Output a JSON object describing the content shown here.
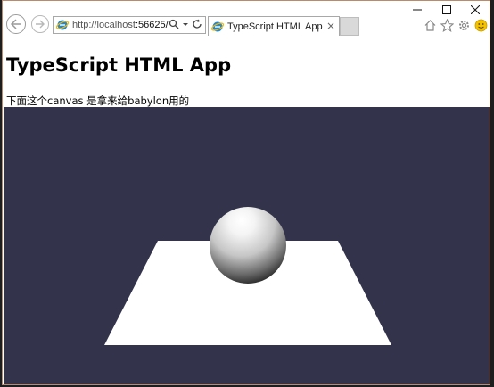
{
  "browser": {
    "address_host": "http://localhost",
    "address_port": ":56625/",
    "tab_title": "TypeScript HTML App",
    "tab_close": "×"
  },
  "page": {
    "heading": "TypeScript HTML App",
    "description": "下面这个canvas 是拿来给babylon用的"
  },
  "scene": {
    "background": "#33334c",
    "ground_color": "#ffffff",
    "objects": [
      "sphere",
      "ground-plane"
    ]
  },
  "colors": {
    "window_border": "#b98a6c",
    "ie_blue": "#1e88d8",
    "ie_ring": "#f5b800"
  }
}
